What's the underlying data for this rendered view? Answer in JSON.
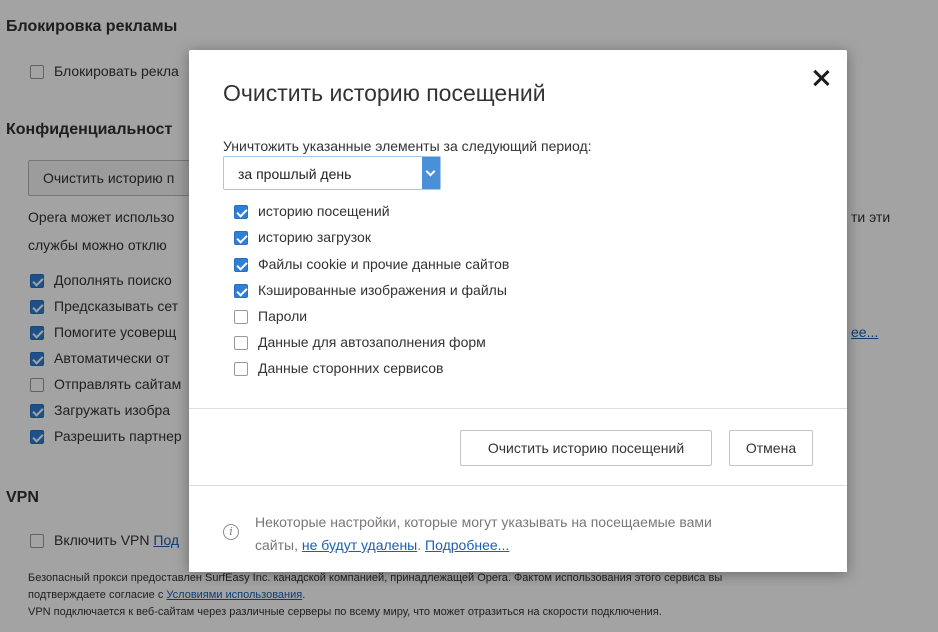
{
  "background": {
    "ads_section": {
      "title": "Блокировка рекламы",
      "block_ads_label": "Блокировать рекла"
    },
    "privacy_section": {
      "title": "Конфиденциальност",
      "clear_history_button": "Очистить историю п",
      "description_line1": "Opera может использо",
      "description_line1_tail": "ти эти",
      "description_line2": "службы можно отклю",
      "items": [
        {
          "label": "Дополнять поиско",
          "checked": true
        },
        {
          "label": "Предсказывать сет",
          "checked": true
        },
        {
          "label": "Помогите усоверщ",
          "checked": true
        },
        {
          "label": "Автоматически от",
          "checked": true
        },
        {
          "label": "Отправлять сайтам",
          "checked": false
        },
        {
          "label": "Загружать изобра",
          "checked": true
        },
        {
          "label": "Разрешить партнер",
          "checked": true
        }
      ],
      "more_link_fragment": "ее..."
    },
    "vpn_section": {
      "title": "VPN",
      "enable_label": "Включить VPN",
      "enable_link": "Под",
      "note_line1": "Безопасный прокси предоставлен SurfEasy Inc. канадской компанией, принадлежащей Opera. Фактом использования этого сервиса вы",
      "note_line2_prefix": "подтверждаете согласие с ",
      "note_line2_link": "Условиями использования",
      "note_line2_suffix": ".",
      "note_line3": "VPN подключается к веб-сайтам через различные серверы по всему миру, что может отразиться на скорости подключения."
    }
  },
  "dialog": {
    "title": "Очистить историю посещений",
    "period_label": "Уничтожить указанные элементы за следующий период:",
    "period_select": {
      "value": "за прошлый день"
    },
    "options": [
      {
        "label": "историю посещений",
        "checked": true
      },
      {
        "label": "историю загрузок",
        "checked": true
      },
      {
        "label": "Файлы cookie и прочие данные сайтов",
        "checked": true
      },
      {
        "label": "Кэшированные изображения и файлы",
        "checked": true
      },
      {
        "label": "Пароли",
        "checked": false
      },
      {
        "label": "Данные для автозаполнения форм",
        "checked": false
      },
      {
        "label": "Данные сторонних сервисов",
        "checked": false
      }
    ],
    "clear_button": "Очистить историю посещений",
    "cancel_button": "Отмена",
    "footer": {
      "line1": "Некоторые настройки, которые могут указывать на посещаемые вами",
      "line2_prefix": "сайты, ",
      "line2_link1": "не будут удалены",
      "line2_middle": ". ",
      "line2_link2": "Подробнее..."
    }
  },
  "colors": {
    "accent": "#2f7ed8",
    "link": "#1a5fb4",
    "overlay": "#5c5c5c"
  },
  "icons": {
    "close": "close-icon",
    "info": "info-icon",
    "dropdown": "chevron-down-icon"
  }
}
